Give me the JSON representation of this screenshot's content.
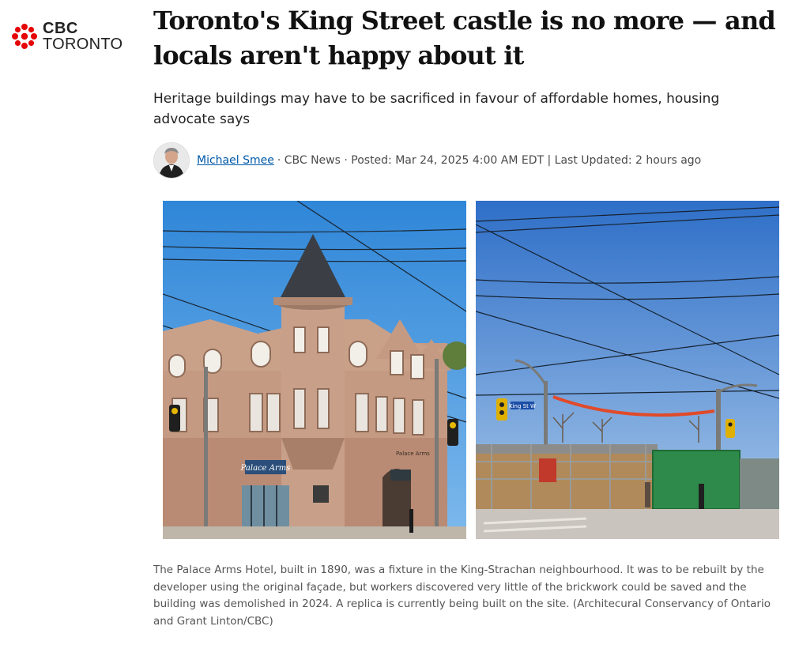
{
  "brand": {
    "wordmark": "CBC",
    "section": "TORONTO",
    "gem_color": "#e60505"
  },
  "article": {
    "headline": "Toronto's King Street castle is no more — and locals aren't happy about it",
    "deck": "Heritage buildings may have to be sacrificed in favour of affordable homes, housing advocate says",
    "author": "Michael Smee",
    "byline_meta": "· CBC News · Posted: Mar 24, 2025 4:00 AM EDT | Last Updated: 2 hours ago",
    "caption": "The Palace Arms Hotel, built in 1890, was a fixture in the King-Strachan neighbourhood. It was to be rebuilt by the developer using the original façade, but workers discovered very little of the brickwork could be saved and the building was demolished in 2024. A replica is currently being built on the site. (Architecural Conservancy of Ontario and Grant Linton/CBC)"
  },
  "photos": {
    "before": {
      "sign_text": "Palace Arms",
      "awning_text": "Palace Arms"
    },
    "after": {
      "street_sign": "King St W"
    }
  },
  "colors": {
    "link": "#0059a8",
    "headline": "#111111",
    "caption": "#555555"
  }
}
